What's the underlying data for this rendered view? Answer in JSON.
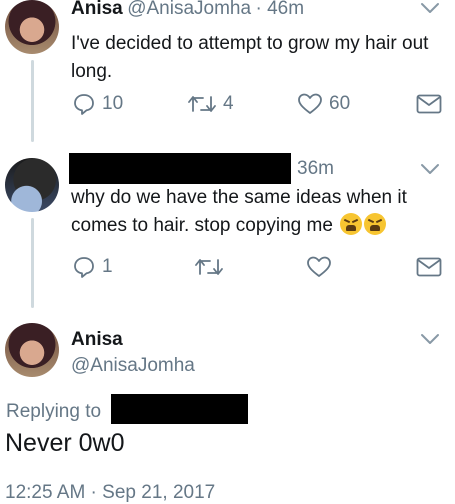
{
  "tweet1": {
    "name": "Anisa",
    "handle": "@AnisaJomha",
    "time": "· 46m",
    "text": "I've decided to attempt to grow my hair out long.",
    "replies": "10",
    "retweets": "4",
    "likes": "60"
  },
  "tweet2": {
    "time": "36m",
    "text": "why do we have the same ideas when it comes to hair. stop copying me",
    "emoji": "weary-face",
    "replies": "1"
  },
  "tweet3": {
    "name": "Anisa",
    "handle": "@AnisaJomha",
    "replying_label": "Replying to",
    "text": "Never 0w0",
    "timestamp": "12:25 AM · Sep 21, 2017"
  },
  "colors": {
    "text": "#14171a",
    "secondary": "#657786",
    "link": "#657786",
    "thread_line": "#cfd9de"
  }
}
